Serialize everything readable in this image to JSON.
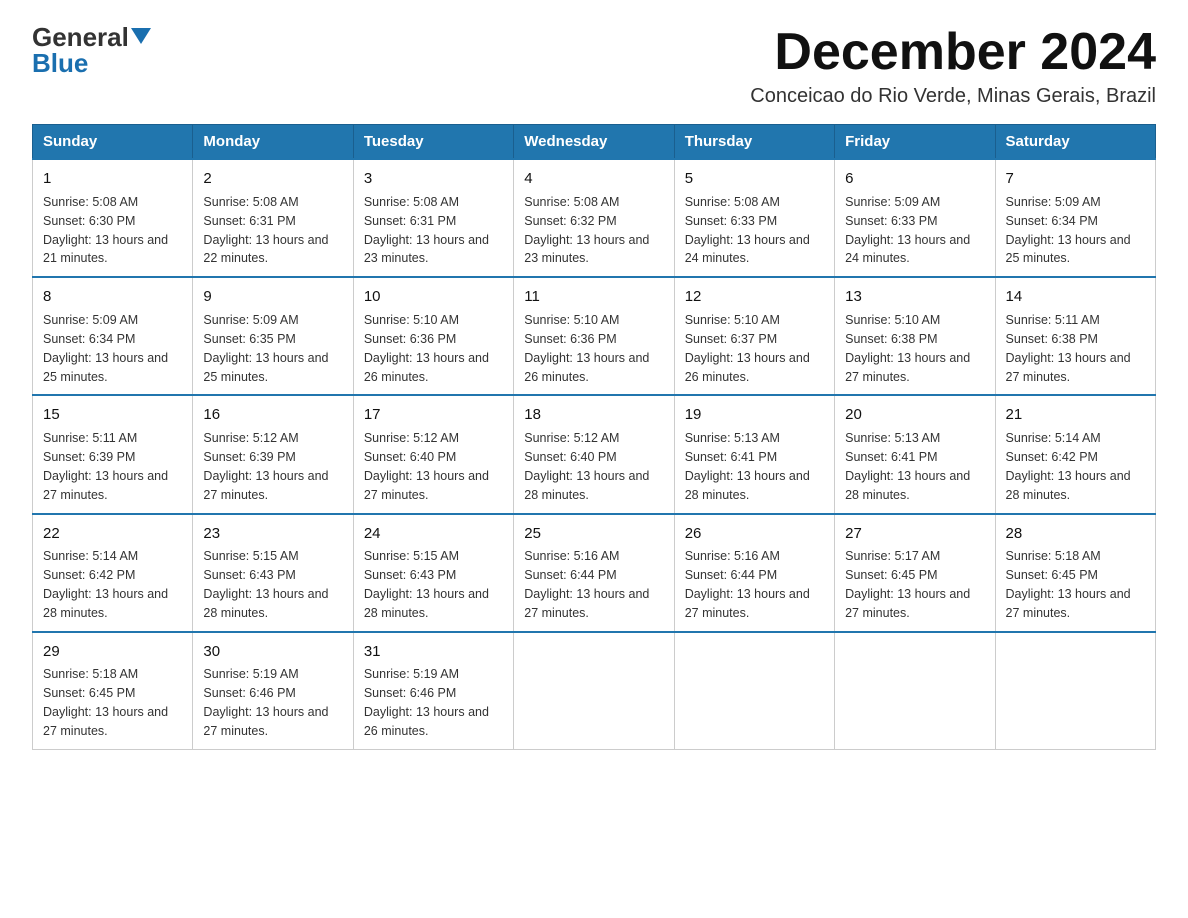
{
  "logo": {
    "general": "General",
    "blue": "Blue"
  },
  "header": {
    "title": "December 2024",
    "subtitle": "Conceicao do Rio Verde, Minas Gerais, Brazil"
  },
  "days_of_week": [
    "Sunday",
    "Monday",
    "Tuesday",
    "Wednesday",
    "Thursday",
    "Friday",
    "Saturday"
  ],
  "weeks": [
    [
      {
        "day": 1,
        "sunrise": "5:08 AM",
        "sunset": "6:30 PM",
        "daylight": "13 hours and 21 minutes."
      },
      {
        "day": 2,
        "sunrise": "5:08 AM",
        "sunset": "6:31 PM",
        "daylight": "13 hours and 22 minutes."
      },
      {
        "day": 3,
        "sunrise": "5:08 AM",
        "sunset": "6:31 PM",
        "daylight": "13 hours and 23 minutes."
      },
      {
        "day": 4,
        "sunrise": "5:08 AM",
        "sunset": "6:32 PM",
        "daylight": "13 hours and 23 minutes."
      },
      {
        "day": 5,
        "sunrise": "5:08 AM",
        "sunset": "6:33 PM",
        "daylight": "13 hours and 24 minutes."
      },
      {
        "day": 6,
        "sunrise": "5:09 AM",
        "sunset": "6:33 PM",
        "daylight": "13 hours and 24 minutes."
      },
      {
        "day": 7,
        "sunrise": "5:09 AM",
        "sunset": "6:34 PM",
        "daylight": "13 hours and 25 minutes."
      }
    ],
    [
      {
        "day": 8,
        "sunrise": "5:09 AM",
        "sunset": "6:34 PM",
        "daylight": "13 hours and 25 minutes."
      },
      {
        "day": 9,
        "sunrise": "5:09 AM",
        "sunset": "6:35 PM",
        "daylight": "13 hours and 25 minutes."
      },
      {
        "day": 10,
        "sunrise": "5:10 AM",
        "sunset": "6:36 PM",
        "daylight": "13 hours and 26 minutes."
      },
      {
        "day": 11,
        "sunrise": "5:10 AM",
        "sunset": "6:36 PM",
        "daylight": "13 hours and 26 minutes."
      },
      {
        "day": 12,
        "sunrise": "5:10 AM",
        "sunset": "6:37 PM",
        "daylight": "13 hours and 26 minutes."
      },
      {
        "day": 13,
        "sunrise": "5:10 AM",
        "sunset": "6:38 PM",
        "daylight": "13 hours and 27 minutes."
      },
      {
        "day": 14,
        "sunrise": "5:11 AM",
        "sunset": "6:38 PM",
        "daylight": "13 hours and 27 minutes."
      }
    ],
    [
      {
        "day": 15,
        "sunrise": "5:11 AM",
        "sunset": "6:39 PM",
        "daylight": "13 hours and 27 minutes."
      },
      {
        "day": 16,
        "sunrise": "5:12 AM",
        "sunset": "6:39 PM",
        "daylight": "13 hours and 27 minutes."
      },
      {
        "day": 17,
        "sunrise": "5:12 AM",
        "sunset": "6:40 PM",
        "daylight": "13 hours and 27 minutes."
      },
      {
        "day": 18,
        "sunrise": "5:12 AM",
        "sunset": "6:40 PM",
        "daylight": "13 hours and 28 minutes."
      },
      {
        "day": 19,
        "sunrise": "5:13 AM",
        "sunset": "6:41 PM",
        "daylight": "13 hours and 28 minutes."
      },
      {
        "day": 20,
        "sunrise": "5:13 AM",
        "sunset": "6:41 PM",
        "daylight": "13 hours and 28 minutes."
      },
      {
        "day": 21,
        "sunrise": "5:14 AM",
        "sunset": "6:42 PM",
        "daylight": "13 hours and 28 minutes."
      }
    ],
    [
      {
        "day": 22,
        "sunrise": "5:14 AM",
        "sunset": "6:42 PM",
        "daylight": "13 hours and 28 minutes."
      },
      {
        "day": 23,
        "sunrise": "5:15 AM",
        "sunset": "6:43 PM",
        "daylight": "13 hours and 28 minutes."
      },
      {
        "day": 24,
        "sunrise": "5:15 AM",
        "sunset": "6:43 PM",
        "daylight": "13 hours and 28 minutes."
      },
      {
        "day": 25,
        "sunrise": "5:16 AM",
        "sunset": "6:44 PM",
        "daylight": "13 hours and 27 minutes."
      },
      {
        "day": 26,
        "sunrise": "5:16 AM",
        "sunset": "6:44 PM",
        "daylight": "13 hours and 27 minutes."
      },
      {
        "day": 27,
        "sunrise": "5:17 AM",
        "sunset": "6:45 PM",
        "daylight": "13 hours and 27 minutes."
      },
      {
        "day": 28,
        "sunrise": "5:18 AM",
        "sunset": "6:45 PM",
        "daylight": "13 hours and 27 minutes."
      }
    ],
    [
      {
        "day": 29,
        "sunrise": "5:18 AM",
        "sunset": "6:45 PM",
        "daylight": "13 hours and 27 minutes."
      },
      {
        "day": 30,
        "sunrise": "5:19 AM",
        "sunset": "6:46 PM",
        "daylight": "13 hours and 27 minutes."
      },
      {
        "day": 31,
        "sunrise": "5:19 AM",
        "sunset": "6:46 PM",
        "daylight": "13 hours and 26 minutes."
      },
      null,
      null,
      null,
      null
    ]
  ]
}
